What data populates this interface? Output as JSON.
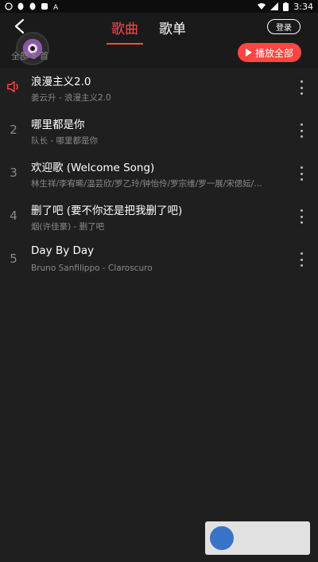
{
  "status": {
    "time": "3:34"
  },
  "header": {
    "tabs": [
      {
        "label": "歌曲"
      },
      {
        "label": "歌单"
      }
    ],
    "login": "登录",
    "play_all": "播放全部",
    "count_label": "全部 5 首"
  },
  "songs": [
    {
      "index": "",
      "title": "浪漫主义2.0",
      "subtitle": "姜云升 - 浪漫主义2.0",
      "playing": true
    },
    {
      "index": "2",
      "title": "哪里都是你",
      "subtitle": "队长 - 哪里都是你"
    },
    {
      "index": "3",
      "title": "欢迎歌 (Welcome Song)",
      "subtitle": "林生祥/李宥晞/温芸欣/罗乙玲/钟怡伶/罗宗维/罗一展/宋偲妘/…"
    },
    {
      "index": "4",
      "title": "删了吧 (要不你还是把我删了吧)",
      "subtitle": "烟(许佳豪) - 删了吧"
    },
    {
      "index": "5",
      "title": "Day By Day",
      "subtitle": "Bruno Sanfilippo - Claroscuro"
    }
  ],
  "colors": {
    "accent": "#ff4444",
    "background": "#1f1f1f"
  }
}
